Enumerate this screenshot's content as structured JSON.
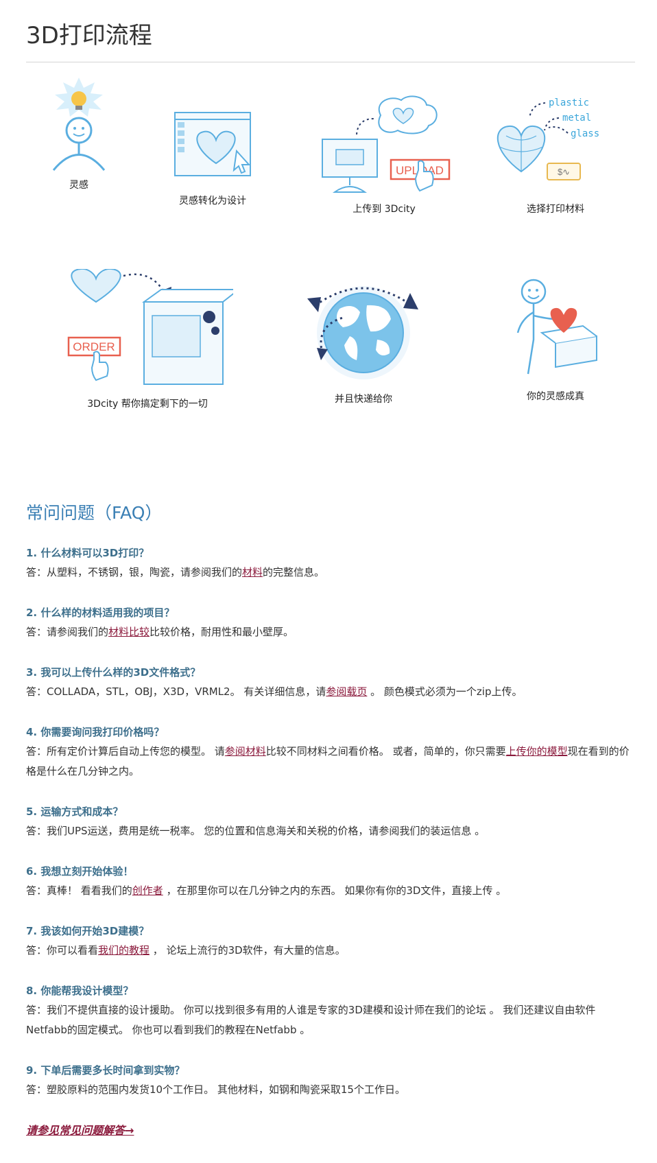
{
  "page": {
    "title": "3D打印流程"
  },
  "process": {
    "steps": [
      {
        "label": "灵感",
        "icon": "lightbulb-person-icon"
      },
      {
        "label": "灵感转化为设计",
        "icon": "design-window-icon"
      },
      {
        "label": "上传到 3Dcity",
        "icon": "upload-computer-icon",
        "button": "UPLOAD"
      },
      {
        "label": "选择打印材料",
        "icon": "materials-heart-icon",
        "materials": [
          "plastic",
          "metal",
          "glass"
        ],
        "price": "$∿"
      },
      {
        "label": "3Dcity 帮你搞定剩下的一切",
        "icon": "order-printer-icon",
        "button": "ORDER"
      },
      {
        "label": "并且快递给你",
        "icon": "globe-shipping-icon"
      },
      {
        "label": "你的灵感成真",
        "icon": "person-heart-box-icon"
      }
    ]
  },
  "faq": {
    "heading": "常问问题（FAQ）",
    "items": [
      {
        "q": "1. 什么材料可以3D打印？",
        "a_pre": "答：从塑料，不锈钢，银，陶瓷，请参阅我们的",
        "link": "材料",
        "a_post": "的完整信息。"
      },
      {
        "q": "2. 什么样的材料适用我的项目？",
        "a_pre": "答：请参阅我们的",
        "link": "材料比较",
        "a_post": "比较价格，耐用性和最小壁厚。"
      },
      {
        "q": "3. 我可以上传什么样的3D文件格式？",
        "a_pre": "答：COLLADA，STL，OBJ，X3D，VRML2。 有关详细信息，请",
        "link": "参阅载页",
        "a_post": " 。 颜色模式必须为一个zip上传。"
      },
      {
        "q": "4. 你需要询问我打印价格吗？",
        "a_pre": "答：所有定价计算后自动上传您的模型。 请",
        "link": "参阅材料",
        "a_mid": "比较不同材料之间看价格。 或者，简单的，你只需要",
        "link2": "上传你的模型",
        "a_post": "现在看到的价格是什么在几分钟之内。"
      },
      {
        "q": "5. 运输方式和成本？",
        "a_pre": "答：我们UPS运送，费用是统一税率。 您的位置和信息海关和关税的价格，请参阅我们的装运信息 。"
      },
      {
        "q": "6. 我想立刻开始体验！",
        "a_pre": "答：真棒！ 看看我们的",
        "link": "创作者",
        "a_post": " ，在那里你可以在几分钟之内的东西。 如果你有你的3D文件，直接上传 。"
      },
      {
        "q": "7. 我该如何开始3D建模？",
        "a_pre": "答：你可以看看",
        "link": "我们的教程",
        "a_post": " ， 论坛上流行的3D软件，有大量的信息。"
      },
      {
        "q": "8. 你能帮我设计模型？",
        "a_pre": "答：我们不提供直接的设计援助。 你可以找到很多有用的人谁是专家的3D建模和设计师在我们的论坛 。 我们还建议自由软件Netfabb的固定模式。 你也可以看到我们的教程在Netfabb 。"
      },
      {
        "q": "9. 下单后需要多长时间拿到实物？",
        "a_pre": "答：塑胶原料的范围内发货10个工作日。 其他材料，如钢和陶瓷采取15个工作日。"
      }
    ],
    "more_link": "请参见常见问题解答→"
  },
  "colors": {
    "accent": "#3a7fb4",
    "link": "#8b1a3c",
    "illustration": "#5aaee0",
    "order_red": "#e8604f"
  }
}
